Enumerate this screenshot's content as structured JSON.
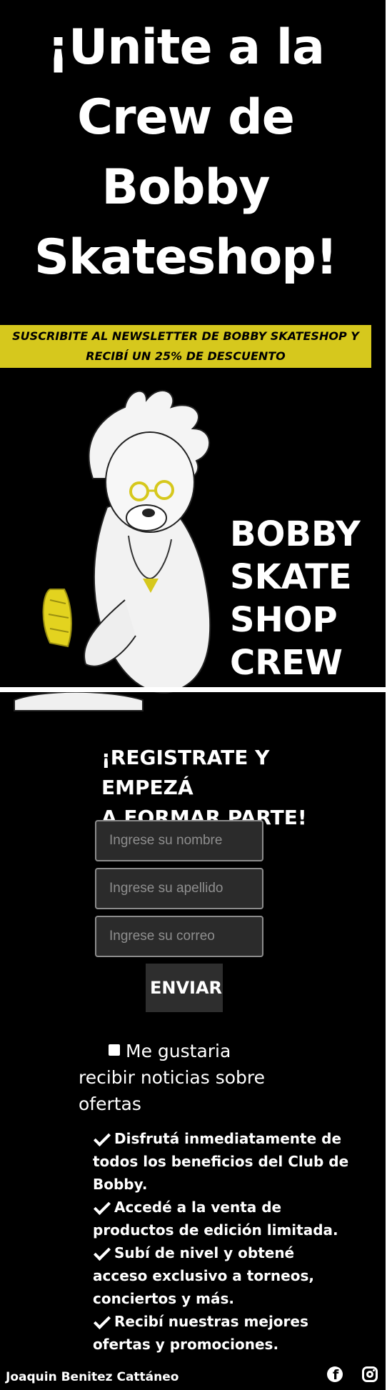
{
  "hero": {
    "title_line1": "¡Unite a la",
    "title_line2": "Crew de",
    "title_line3": "Bobby",
    "title_line4": "Skateshop!",
    "banner_line1": "SUSCRIBITE AL NEWSLETTER DE BOBBY SKATESHOP Y",
    "banner_line2": "RECIBÍ UN 25% DE DESCUENTO"
  },
  "illustration": {
    "logo_lines": [
      "BOBBY",
      "SKATE",
      "SHOP",
      "CREW"
    ]
  },
  "register": {
    "title_line1": "¡REGISTRATE Y EMPEZÁ",
    "title_line2": "A FORMAR PARTE!",
    "name_placeholder": "Ingrese su nombre",
    "lastname_placeholder": "Ingrese su apellido",
    "email_placeholder": "Ingrese su correo",
    "submit_label": "ENVIAR"
  },
  "optin": {
    "label": "Me gustaria recibir noticias sobre ofertas",
    "checked": false
  },
  "benefits": [
    "Disfrutá inmediatamente de todos los beneficios del Club de Bobby.",
    "Accedé a la venta de productos de edición limitada.",
    "Subí de nivel y obtené acceso exclusivo a torneos, conciertos y más.",
    "Recibí nuestras mejores ofertas y promociones."
  ],
  "footer": {
    "author": "Joaquin Benitez Cattáneo",
    "social_icons": [
      "facebook-icon",
      "instagram-icon"
    ]
  },
  "colors": {
    "background": "#000000",
    "accent_yellow": "#d6c81d",
    "text": "#ffffff"
  }
}
